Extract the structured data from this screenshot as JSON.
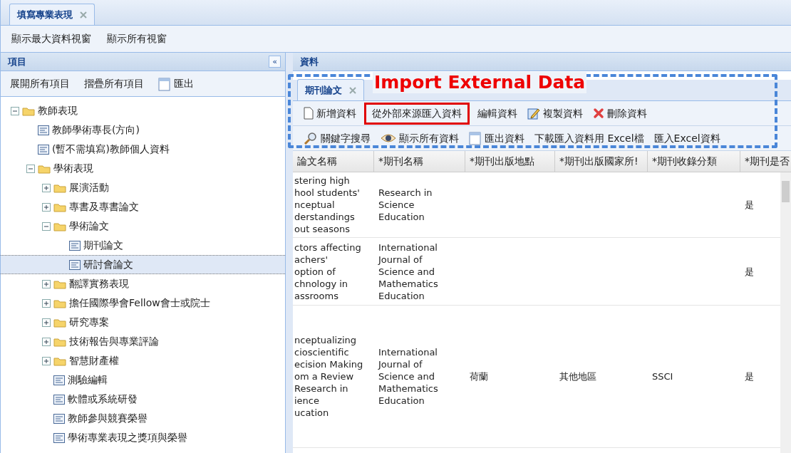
{
  "tabs": [
    {
      "label": "填寫專業表現",
      "selected": true
    }
  ],
  "top_toolbar": [
    "顯示最大資料視窗",
    "顯示所有視窗"
  ],
  "left_panel": {
    "title": "項目",
    "collapse": "«",
    "toolbar": [
      {
        "label": "展開所有項目",
        "kind": "plain"
      },
      {
        "label": "摺疊所有項目",
        "kind": "plain"
      },
      {
        "label": "匯出",
        "kind": "export"
      }
    ],
    "tree": [
      {
        "label": "教師表現",
        "kind": "folder",
        "expanded": true,
        "selected": false,
        "children": [
          {
            "label": "教師學術專長(方向)",
            "kind": "item",
            "selected": false
          },
          {
            "label": "(暫不需填寫)教師個人資料",
            "kind": "item",
            "selected": false
          },
          {
            "label": "學術表現",
            "kind": "folder",
            "expanded": true,
            "selected": false,
            "children": [
              {
                "label": "展演活動",
                "kind": "folder",
                "expanded": false,
                "selected": false
              },
              {
                "label": "專書及專書論文",
                "kind": "folder",
                "expanded": false,
                "selected": false
              },
              {
                "label": "學術論文",
                "kind": "folder",
                "expanded": true,
                "selected": false,
                "children": [
                  {
                    "label": "期刊論文",
                    "kind": "item",
                    "selected": false
                  },
                  {
                    "label": "研討會論文",
                    "kind": "item",
                    "selected": true
                  }
                ]
              },
              {
                "label": "翻譯實務表現",
                "kind": "folder",
                "expanded": false,
                "selected": false
              },
              {
                "label": "擔任國際學會Fellow會士或院士",
                "kind": "folder",
                "expanded": false,
                "selected": false
              },
              {
                "label": "研究專案",
                "kind": "folder",
                "expanded": false,
                "selected": false
              },
              {
                "label": "技術報告與專業評論",
                "kind": "folder",
                "expanded": false,
                "selected": false
              },
              {
                "label": "智慧財產權",
                "kind": "folder",
                "expanded": false,
                "selected": false
              },
              {
                "label": "測驗編輯",
                "kind": "item",
                "selected": false
              },
              {
                "label": "軟體或系統研發",
                "kind": "item",
                "selected": false
              },
              {
                "label": "教師參與競賽榮譽",
                "kind": "item",
                "selected": false
              },
              {
                "label": "學術專業表現之獎項與榮譽",
                "kind": "item",
                "selected": false
              }
            ]
          }
        ]
      }
    ]
  },
  "data_panel": {
    "title": "資料",
    "tabs": [
      {
        "label": "期刊論文",
        "selected": true
      }
    ],
    "toolbar_rows": [
      [
        {
          "label": "新增資料",
          "kind": "new",
          "highlighted": false
        },
        {
          "label": "從外部來源匯入資料",
          "kind": "plain",
          "highlighted": true
        },
        {
          "label": "編輯資料",
          "kind": "plain",
          "highlighted": false
        },
        {
          "label": "複製資料",
          "kind": "copy",
          "highlighted": false
        },
        {
          "label": "刪除資料",
          "kind": "delete",
          "highlighted": false
        }
      ],
      [
        {
          "label": "關鍵字搜尋",
          "kind": "search",
          "highlighted": false
        },
        {
          "label": "顯示所有資料",
          "kind": "view",
          "highlighted": false
        },
        {
          "label": "匯出資料",
          "kind": "export",
          "highlighted": false
        },
        {
          "label": "下載匯入資料用 Excel檔",
          "kind": "plain",
          "highlighted": false
        },
        {
          "label": "匯入Excel資料",
          "kind": "plain",
          "highlighted": false
        }
      ]
    ],
    "table": {
      "columns": [
        "論文名稱",
        "*期刊名稱",
        "*期刊出版地點",
        "*期刊出版國家所!",
        "*期刊收錄分類",
        "*期刊是否"
      ],
      "rows": [
        {
          "cells": [
            "stering high\nhool students'\nnceptual\nderstandings\nout seasons",
            "Research in\nScience\nEducation",
            "",
            "",
            "",
            "是"
          ]
        },
        {
          "cells": [
            "ctors affecting\nachers'\noption of\nchnology in\nassrooms",
            "International\nJournal of\nScience and\nMathematics\nEducation",
            "",
            "",
            "",
            "是"
          ]
        },
        {
          "cells": [
            "nceptualizing\ncioscientific\necision Making\nom a Review\nResearch in\nience\nucation",
            "International\nJournal of\nScience and\nMathematics\nEducation",
            "荷蘭",
            "其他地區",
            "SSCI",
            "是"
          ]
        }
      ]
    }
  },
  "annotation": {
    "label": "Import External Data"
  }
}
